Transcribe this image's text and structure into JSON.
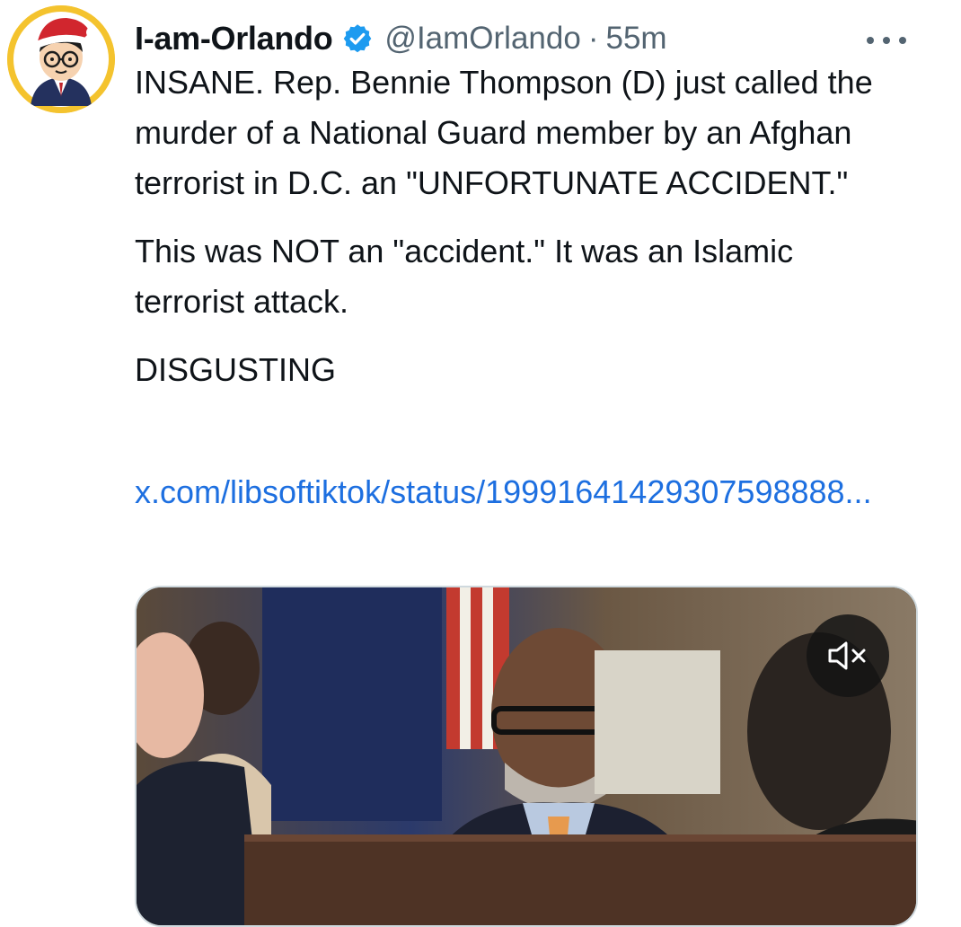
{
  "author": {
    "display_name": "I-am-Orlando",
    "handle": "@IamOrlando",
    "separator": "·",
    "time": "55m",
    "verified_icon": "verified-badge-icon",
    "avatar_icon": "cartoon-avatar-icon"
  },
  "tweet": {
    "text_line_1": "INSANE. Rep. Bennie Thompson (D) just called the murder of a National Guard member by an Afghan terrorist in D.C. an \"UNFORTUNATE ACCIDENT.\"",
    "text_line_2": "This was NOT an \"accident.\" It was an Islamic terrorist attack.",
    "text_line_3": "DISGUSTING",
    "link_text": "x.com/libsoftiktok/status/19991641429307598888..."
  },
  "media": {
    "type": "video",
    "mute_icon": "muted-speaker-icon"
  },
  "menu": {
    "more_icon": "more-options-icon"
  },
  "colors": {
    "accent_link": "#1d6fe0",
    "verified_blue": "#1d9bf0",
    "secondary_text": "#536471",
    "avatar_ring": "#f4c32e"
  }
}
